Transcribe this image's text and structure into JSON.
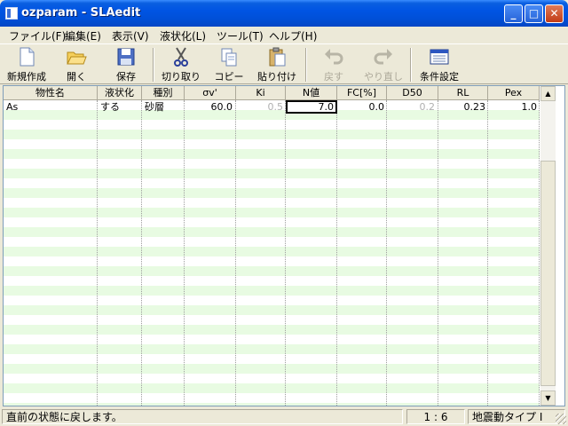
{
  "window": {
    "title": "ozparam - SLAedit"
  },
  "titlebar_buttons": {
    "minimize": "_",
    "maximize": "□",
    "close": "✕"
  },
  "menu": [
    {
      "label": "ファイル(F)"
    },
    {
      "label": "編集(E)"
    },
    {
      "label": "表示(V)"
    },
    {
      "label": "液状化(L)"
    },
    {
      "label": "ツール(T)"
    },
    {
      "label": "ヘルプ(H)"
    }
  ],
  "toolbar": {
    "new": "新規作成",
    "open": "開く",
    "save": "保存",
    "cut": "切り取り",
    "copy": "コピー",
    "paste": "貼り付け",
    "undo": "戻す",
    "redo": "やり直し",
    "conditions": "条件設定"
  },
  "grid": {
    "columns": [
      "物性名",
      "液状化",
      "種別",
      "σv'",
      "Ki",
      "N値",
      "FC[%]",
      "D50",
      "RL",
      "Pex"
    ],
    "rows": [
      {
        "name": "As",
        "liquefaction": "する",
        "type": "砂層",
        "sigma_v": "60.0",
        "ki": "0.5",
        "n_value": "7.0",
        "fc": "0.0",
        "d50": "0.2",
        "rl": "0.23",
        "pex": "1.0"
      }
    ],
    "stripe_color": "#e8fbe2"
  },
  "scrollbar": {
    "up": "▲",
    "down": "▼"
  },
  "status": {
    "message": "直前の状態に戻します。",
    "position": "1 : 6",
    "mode": "地震動タイプ I"
  }
}
